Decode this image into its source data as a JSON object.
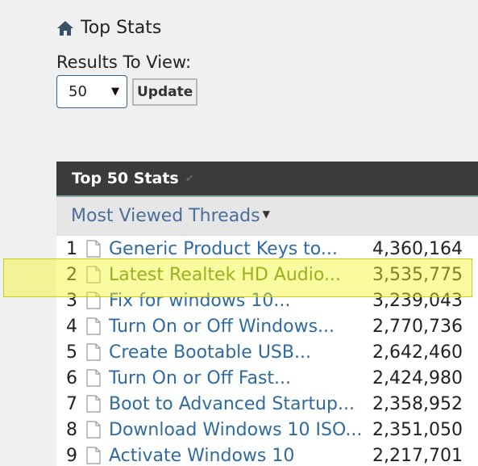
{
  "breadcrumb": {
    "icon": "home-icon",
    "label": "Top Stats"
  },
  "results": {
    "label": "Results To View:",
    "selected": "50",
    "update_label": "Update"
  },
  "panel": {
    "title": "Top 50 Stats",
    "tab_label": "Most Viewed Threads",
    "rows": [
      {
        "rank": "1",
        "title": "Generic Product Keys to...",
        "views": "4,360,164"
      },
      {
        "rank": "2",
        "title": "Latest Realtek HD Audio...",
        "views": "3,535,775",
        "highlighted": true
      },
      {
        "rank": "3",
        "title": "Fix for windows 10...",
        "views": "3,239,043"
      },
      {
        "rank": "4",
        "title": "Turn On or Off Windows...",
        "views": "2,770,736"
      },
      {
        "rank": "5",
        "title": "Create Bootable USB...",
        "views": "2,642,460"
      },
      {
        "rank": "6",
        "title": "Turn On or Off Fast...",
        "views": "2,424,980"
      },
      {
        "rank": "7",
        "title": "Boot to Advanced Startup...",
        "views": "2,358,952"
      },
      {
        "rank": "8",
        "title": "Download Windows 10 ISO...",
        "views": "2,351,050"
      },
      {
        "rank": "9",
        "title": "Activate Windows 10",
        "views": "2,217,701"
      }
    ]
  },
  "colors": {
    "link": "#2f6aa0",
    "highlight_title": "#4f7a1a",
    "header_bg": "#3b3b3b",
    "highlight_fill": "#f5f528"
  }
}
